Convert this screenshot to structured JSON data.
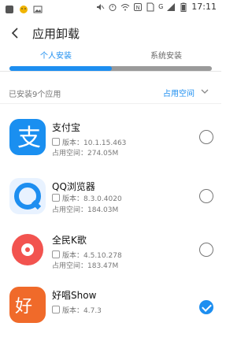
{
  "status_bar": {
    "time": "17:11",
    "network": "G",
    "icons": [
      "notification-icon",
      "emoji-icon",
      "image-icon",
      "mute-icon",
      "alarm-icon",
      "wifi-icon",
      "nfc-icon",
      "sim-icon",
      "signal-icon",
      "battery-icon"
    ]
  },
  "header": {
    "title": "应用卸载",
    "back_icon": "back-icon"
  },
  "tabs": [
    {
      "label": "个人安装",
      "active": true
    },
    {
      "label": "系统安装",
      "active": false
    }
  ],
  "summary": {
    "count_text": "已安装9个应用",
    "sort_label": "占用空间"
  },
  "apps": [
    {
      "name": "支付宝",
      "version": "版本：10.1.15.463",
      "size": "占用空间：274.05M",
      "selected": false,
      "icon": "alipay-icon"
    },
    {
      "name": "QQ浏览器",
      "version": "版本：8.3.0.4020",
      "size": "占用空间：184.03M",
      "selected": false,
      "icon": "qq-browser-icon"
    },
    {
      "name": "全民K歌",
      "version": "版本：4.5.10.278",
      "size": "占用空间：183.47M",
      "selected": false,
      "icon": "kge-icon"
    },
    {
      "name": "好唱Show",
      "version": "版本：4.7.3",
      "size": "",
      "selected": true,
      "icon": "haochang-icon"
    }
  ],
  "colors": {
    "accent": "#1d8ef0",
    "alipay": "#1a8ff0",
    "kge": "#f2534f",
    "haochang": "#f06a2a"
  }
}
